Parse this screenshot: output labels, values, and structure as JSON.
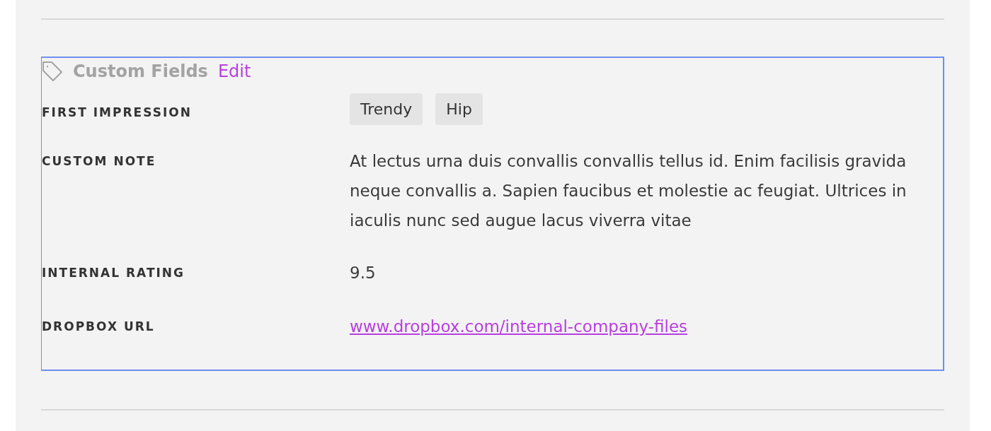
{
  "section": {
    "title": "Custom Fields",
    "edit_link": "Edit",
    "selected": true
  },
  "fields": [
    {
      "label": "FIRST IMPRESSION",
      "kind": "tags",
      "tags": [
        "Trendy",
        "Hip"
      ]
    },
    {
      "label": "CUSTOM NOTE",
      "kind": "text",
      "value": "At lectus urna duis convallis convallis tellus id. Enim facilisis gravida neque convallis a. Sapien faucibus et molestie ac feugiat. Ultrices in iaculis nunc sed augue lacus viverra vitae"
    },
    {
      "label": "INTERNAL RATING",
      "kind": "text",
      "value": "9.5"
    },
    {
      "label": "DROPBOX URL",
      "kind": "link",
      "value": "www.dropbox.com/internal-company-files"
    }
  ]
}
